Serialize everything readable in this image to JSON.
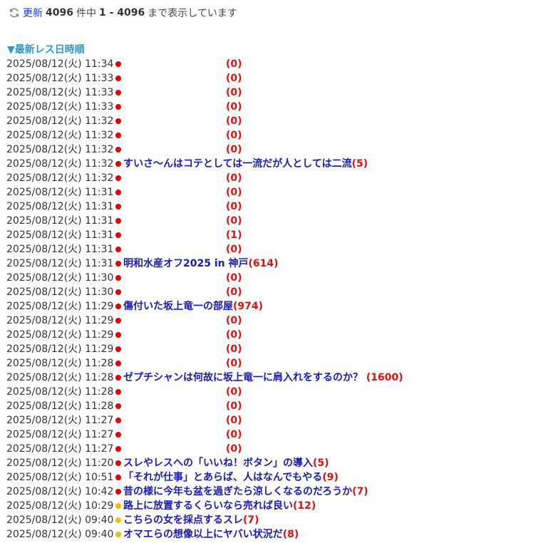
{
  "header": {
    "refresh_label": "更新",
    "total": "4096",
    "text_of": "件中",
    "range": "1 - 4096",
    "text_shown": "まで表示しています"
  },
  "sort_label": "▼最新レス日時順",
  "colors": {
    "new": "#e00000",
    "old": "#f0c000",
    "link": "#1a1ab4",
    "count": "#e01010"
  },
  "threads": [
    {
      "date": "2025/08/12(火) 11:34",
      "dot": "red",
      "title": "",
      "count": "(0)"
    },
    {
      "date": "2025/08/12(火) 11:33",
      "dot": "red",
      "title": "",
      "count": "(0)"
    },
    {
      "date": "2025/08/12(火) 11:33",
      "dot": "red",
      "title": "",
      "count": "(0)"
    },
    {
      "date": "2025/08/12(火) 11:33",
      "dot": "red",
      "title": "",
      "count": "(0)"
    },
    {
      "date": "2025/08/12(火) 11:32",
      "dot": "red",
      "title": "",
      "count": "(0)"
    },
    {
      "date": "2025/08/12(火) 11:32",
      "dot": "red",
      "title": "",
      "count": "(0)"
    },
    {
      "date": "2025/08/12(火) 11:32",
      "dot": "red",
      "title": "",
      "count": "(0)"
    },
    {
      "date": "2025/08/12(火) 11:32",
      "dot": "red",
      "title": "すいさ～んはコテとしては一流だが人としては二流",
      "count": "(5)"
    },
    {
      "date": "2025/08/12(火) 11:32",
      "dot": "red",
      "title": "",
      "count": "(0)"
    },
    {
      "date": "2025/08/12(火) 11:31",
      "dot": "red",
      "title": "",
      "count": "(0)"
    },
    {
      "date": "2025/08/12(火) 11:31",
      "dot": "red",
      "title": "",
      "count": "(0)"
    },
    {
      "date": "2025/08/12(火) 11:31",
      "dot": "red",
      "title": "",
      "count": "(0)"
    },
    {
      "date": "2025/08/12(火) 11:31",
      "dot": "red",
      "title": "",
      "count": "(1)"
    },
    {
      "date": "2025/08/12(火) 11:31",
      "dot": "red",
      "title": "",
      "count": "(0)"
    },
    {
      "date": "2025/08/12(火) 11:31",
      "dot": "red",
      "title": "明和水産オフ2025 in 神戸",
      "count": "(614)"
    },
    {
      "date": "2025/08/12(火) 11:30",
      "dot": "red",
      "title": "",
      "count": "(0)"
    },
    {
      "date": "2025/08/12(火) 11:30",
      "dot": "red",
      "title": "",
      "count": "(0)"
    },
    {
      "date": "2025/08/12(火) 11:29",
      "dot": "red",
      "title": "傷付いた坂上竜一の部屋",
      "count": "(974)"
    },
    {
      "date": "2025/08/12(火) 11:29",
      "dot": "red",
      "title": "",
      "count": "(0)"
    },
    {
      "date": "2025/08/12(火) 11:29",
      "dot": "red",
      "title": "",
      "count": "(0)"
    },
    {
      "date": "2025/08/12(火) 11:29",
      "dot": "red",
      "title": "",
      "count": "(0)"
    },
    {
      "date": "2025/08/12(火) 11:28",
      "dot": "red",
      "title": "",
      "count": "(0)"
    },
    {
      "date": "2025/08/12(火) 11:28",
      "dot": "red",
      "title": "ゼプチシャンは何故に坂上竜一に肩入れをするのか？",
      "count": " (1600)"
    },
    {
      "date": "2025/08/12(火) 11:28",
      "dot": "red",
      "title": "",
      "count": "(0)"
    },
    {
      "date": "2025/08/12(火) 11:28",
      "dot": "red",
      "title": "",
      "count": "(0)"
    },
    {
      "date": "2025/08/12(火) 11:27",
      "dot": "red",
      "title": "",
      "count": "(0)"
    },
    {
      "date": "2025/08/12(火) 11:27",
      "dot": "red",
      "title": "",
      "count": "(0)"
    },
    {
      "date": "2025/08/12(火) 11:27",
      "dot": "red",
      "title": "",
      "count": "(0)"
    },
    {
      "date": "2025/08/12(火) 11:20",
      "dot": "red",
      "title": "スレやレスへの「いいね！ボタン」の導入",
      "count": "(5)"
    },
    {
      "date": "2025/08/12(火) 10:51",
      "dot": "red",
      "title": "「それが仕事」とあらば、人はなんでもやる",
      "count": "(9)"
    },
    {
      "date": "2025/08/12(火) 10:42",
      "dot": "red",
      "title": "昔の様に今年も盆を過ぎたら涼しくなるのだろうか",
      "count": "(7)"
    },
    {
      "date": "2025/08/12(火) 10:29",
      "dot": "yellow",
      "title": "路上に放置するくらいなら売れば良い",
      "count": "(12)"
    },
    {
      "date": "2025/08/12(火) 09:40",
      "dot": "yellow",
      "title": "こちらの女を採点するスレ",
      "count": "(7)"
    },
    {
      "date": "2025/08/12(火) 09:40",
      "dot": "yellow",
      "title": "オマエらの想像以上にヤバい状況だ",
      "count": "(8)"
    }
  ]
}
